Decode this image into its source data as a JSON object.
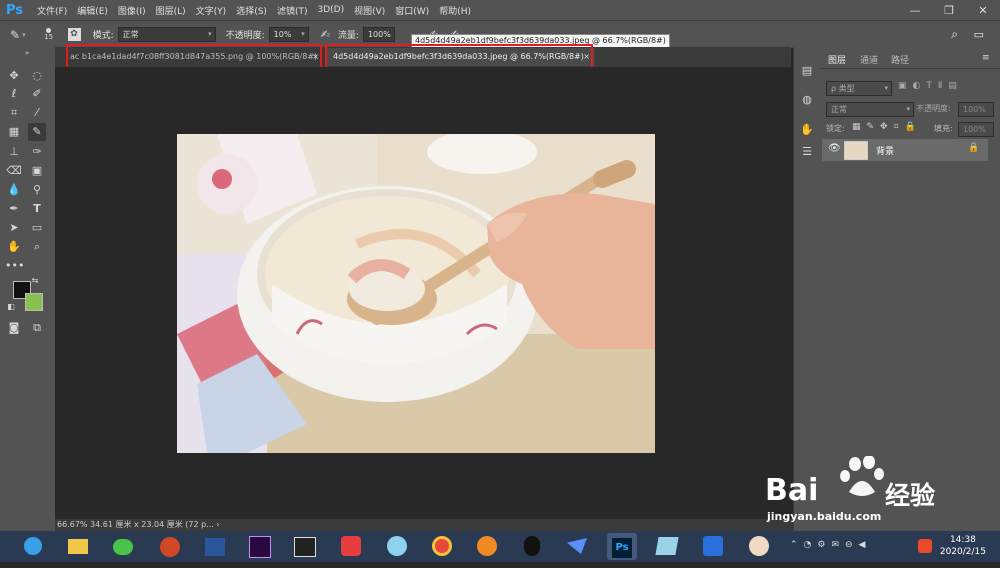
{
  "app": {
    "logo": "Ps"
  },
  "menus": [
    "文件(F)",
    "编辑(E)",
    "图像(I)",
    "图层(L)",
    "文字(Y)",
    "选择(S)",
    "滤镜(T)",
    "3D(D)",
    "视图(V)",
    "窗口(W)",
    "帮助(H)"
  ],
  "window_controls": {
    "minimize": "—",
    "restore": "❐",
    "close": "✕"
  },
  "options": {
    "brush_size": "15",
    "mode_label": "模式:",
    "mode_value": "正常",
    "opacity_label": "不透明度:",
    "opacity_value": "10%",
    "flow_label": "流量:",
    "flow_value": "100%"
  },
  "tooltip": "4d5d4d49a2eb1df9befc3f3d639da033.jpeg @ 66.7%(RGB/8#)",
  "tabs": [
    {
      "label": "ac b1ca4e1dad4f7c08ff3081d847a355.png @ 100%(RGB/8#)",
      "close": "×",
      "active": false
    },
    {
      "label": "4d5d4d49a2eb1df9befc3f3d639da033.jpeg @ 66.7%(RGB/8#)",
      "close": "×",
      "active": true
    }
  ],
  "status": "66.67%   34.61 厘米 x 23.04 厘米 (72 p...  ›",
  "layers_panel": {
    "tabs": [
      "图层",
      "通道",
      "路径"
    ],
    "filter_placeholder": "ρ 类型",
    "blend_mode": "正常",
    "opacity_label": "不透明度:",
    "opacity_value": "100%",
    "lock_label": "锁定:",
    "fill_label": "填充:",
    "fill_value": "100%",
    "layers": [
      {
        "name": "背景",
        "visible": true,
        "locked": true
      }
    ]
  },
  "taskbar": {
    "apps": [
      "browser",
      "file-explorer",
      "wechat",
      "powerpoint",
      "word",
      "premiere",
      "video-editor",
      "office-app",
      "qq-app",
      "chrome",
      "media-player",
      "qq",
      "feishu",
      "photoshop",
      "notes-app",
      "wps",
      "game-app"
    ],
    "active_app": "photoshop",
    "time": "14:38",
    "date": "2020/2/15"
  },
  "watermark": {
    "brand": "Bai",
    "brand2": "经验",
    "url": "jingyan.baidu.com"
  },
  "colors": {
    "foreground": "#111111",
    "background": "#8cbf52",
    "accent": "#31a8ff",
    "highlight": "#e01e1e"
  }
}
